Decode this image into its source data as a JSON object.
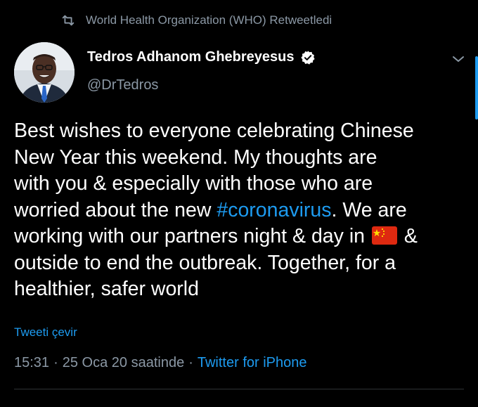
{
  "retweet_header": {
    "icon": "retweet-icon",
    "text": "World Health Organization (WHO) Retweetledi"
  },
  "author": {
    "name": "Tedros Adhanom Ghebreyesus",
    "handle": "@DrTedros",
    "verified_icon": "verified-badge-icon"
  },
  "tweet": {
    "lines": [
      {
        "pre": "Best wishes to everyone celebrating Chinese",
        "hashtag": "",
        "post": ""
      },
      {
        "pre": "New Year this weekend. My thoughts are",
        "hashtag": "",
        "post": ""
      },
      {
        "pre": "with you & especially with those who are",
        "hashtag": "",
        "post": ""
      },
      {
        "pre": "worried about the new ",
        "hashtag": "#coronavirus",
        "post": ". We are"
      },
      {
        "pre": "working with our partners night & day in ",
        "hashtag": "",
        "post": " &"
      },
      {
        "pre": "outside to end the outbreak. Together, for a",
        "hashtag": "",
        "post": ""
      },
      {
        "pre": "healthier, safer world",
        "hashtag": "",
        "post": ""
      }
    ],
    "flag_icon": "china-flag-icon"
  },
  "translate_label": "Tweeti çevir",
  "meta": {
    "time": "15:31",
    "separator": "·",
    "date": "25 Oca 20 saatinde",
    "source": "Twitter for iPhone"
  },
  "colors": {
    "background": "#000000",
    "text": "#ffffff",
    "secondary": "#8b98a5",
    "accent": "#1d9bf0",
    "flag_red": "#de2910",
    "flag_yellow": "#ffde00"
  }
}
